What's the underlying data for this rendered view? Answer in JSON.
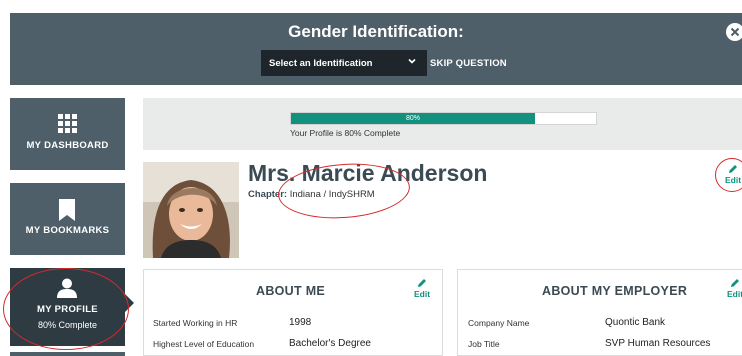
{
  "gender_banner": {
    "title": "Gender Identification:",
    "select_value": "Select an Identification",
    "skip_label": "SKIP QUESTION"
  },
  "sidebar": {
    "items": [
      {
        "label": "MY DASHBOARD",
        "icon": "grid-icon"
      },
      {
        "label": "MY BOOKMARKS",
        "icon": "bookmark-icon"
      },
      {
        "label": "MY PROFILE",
        "sub": "80% Complete",
        "icon": "user-icon",
        "active": true
      }
    ]
  },
  "progress": {
    "percent": 80,
    "bar_label": "80%",
    "caption": "Your Profile is 80% Complete"
  },
  "profile": {
    "name": "Mrs. Marcie Anderson",
    "chapter_label": "Chapter:",
    "chapter_value": "Indiana / IndySHRM",
    "edit_label": "Edit"
  },
  "about_me": {
    "title": "ABOUT ME",
    "edit_label": "Edit",
    "rows": [
      {
        "label": "Started Working in HR",
        "value": "1998"
      },
      {
        "label": "Highest Level of Education",
        "value": "Bachelor's Degree"
      }
    ]
  },
  "about_employer": {
    "title": "ABOUT MY EMPLOYER",
    "edit_label": "Edit",
    "rows": [
      {
        "label": "Company Name",
        "value": "Quontic Bank"
      },
      {
        "label": "Job Title",
        "value": "SVP Human Resources"
      }
    ]
  },
  "colors": {
    "panel": "#4e5f69",
    "active": "#2e3b43",
    "accent": "#12927e",
    "annotation": "#d42a2a"
  }
}
